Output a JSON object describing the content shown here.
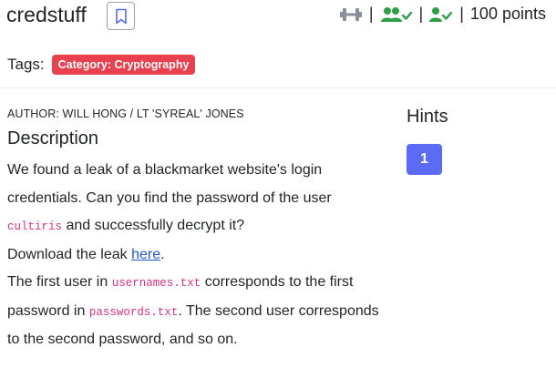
{
  "challenge": {
    "title": "credstuff",
    "points": "100 points",
    "tags_label": "Tags:",
    "category": "Category: Cryptography"
  },
  "stats_icons": [
    "dumbbell-icon",
    "users-check-icon",
    "user-check-icon"
  ],
  "stats_separator": "|",
  "colors": {
    "accent": "#5b6bf4",
    "badge": "#e8404e",
    "success": "#2f9e44",
    "code": "#d63384",
    "link": "#2357d6"
  },
  "author": "AUTHOR: WILL HONG / LT 'SYREAL' JONES",
  "description": {
    "heading": "Description",
    "p1": "We found a leak of a blackmarket website's login credentials. Can you find the password of the user",
    "p1_code": "cultiris",
    "p1_end": "and successfully decrypt it?",
    "p2": "Download the leak",
    "p2_link": "here",
    "p2_end": ".",
    "p3_a": "The first user in",
    "p3_code1": "usernames.txt",
    "p3_b": "corresponds to the first password in",
    "p3_code2": "passwords.txt",
    "p3_c": ". The second user corresponds to the second password, and so on."
  },
  "hints": {
    "title": "Hints",
    "items": [
      "1"
    ]
  }
}
